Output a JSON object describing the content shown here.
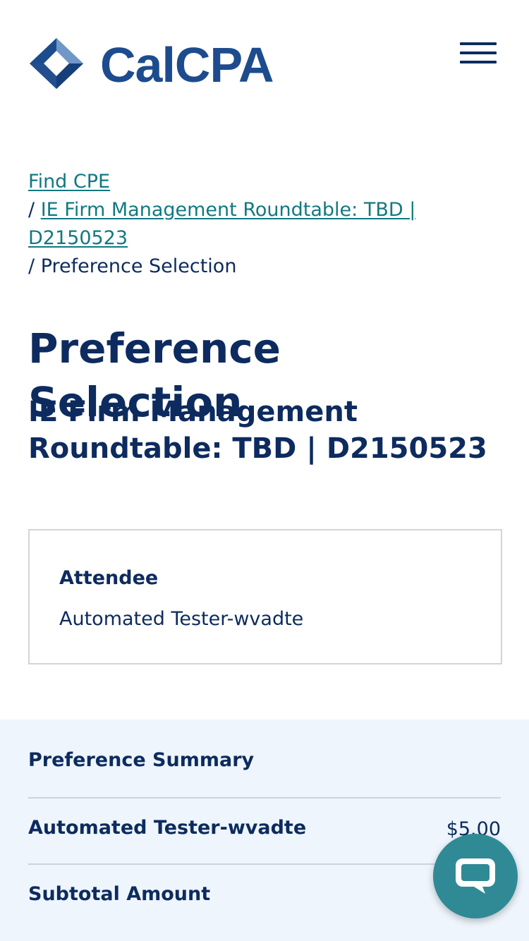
{
  "brand": {
    "name": "CalCPA",
    "logo_icon": "calcpa-cube-logo",
    "color": "#1d4c8e"
  },
  "header": {
    "menu_icon": "hamburger-menu-icon"
  },
  "breadcrumb": {
    "items": [
      {
        "label": "Find CPE",
        "link": true
      },
      {
        "label": "IE Firm Management Roundtable: TBD | D2150523",
        "link": true
      },
      {
        "label": "Preference Selection",
        "link": false
      }
    ],
    "separator": "/"
  },
  "page": {
    "title": "Preference Selection",
    "event_title": "IE Firm Management Roundtable: TBD | D2150523"
  },
  "attendee": {
    "label": "Attendee",
    "name": "Automated Tester-wvadte"
  },
  "summary": {
    "heading": "Preference Summary",
    "rows": [
      {
        "label": "Automated Tester-wvadte",
        "value": "$5.00"
      },
      {
        "label": "Subtotal Amount",
        "value": ""
      }
    ]
  },
  "chat": {
    "icon": "chat-bubble-icon",
    "color": "#2f8a96"
  },
  "colors": {
    "text": "#0d2b5e",
    "link": "#127980",
    "summary_bg": "#eef5fd"
  }
}
